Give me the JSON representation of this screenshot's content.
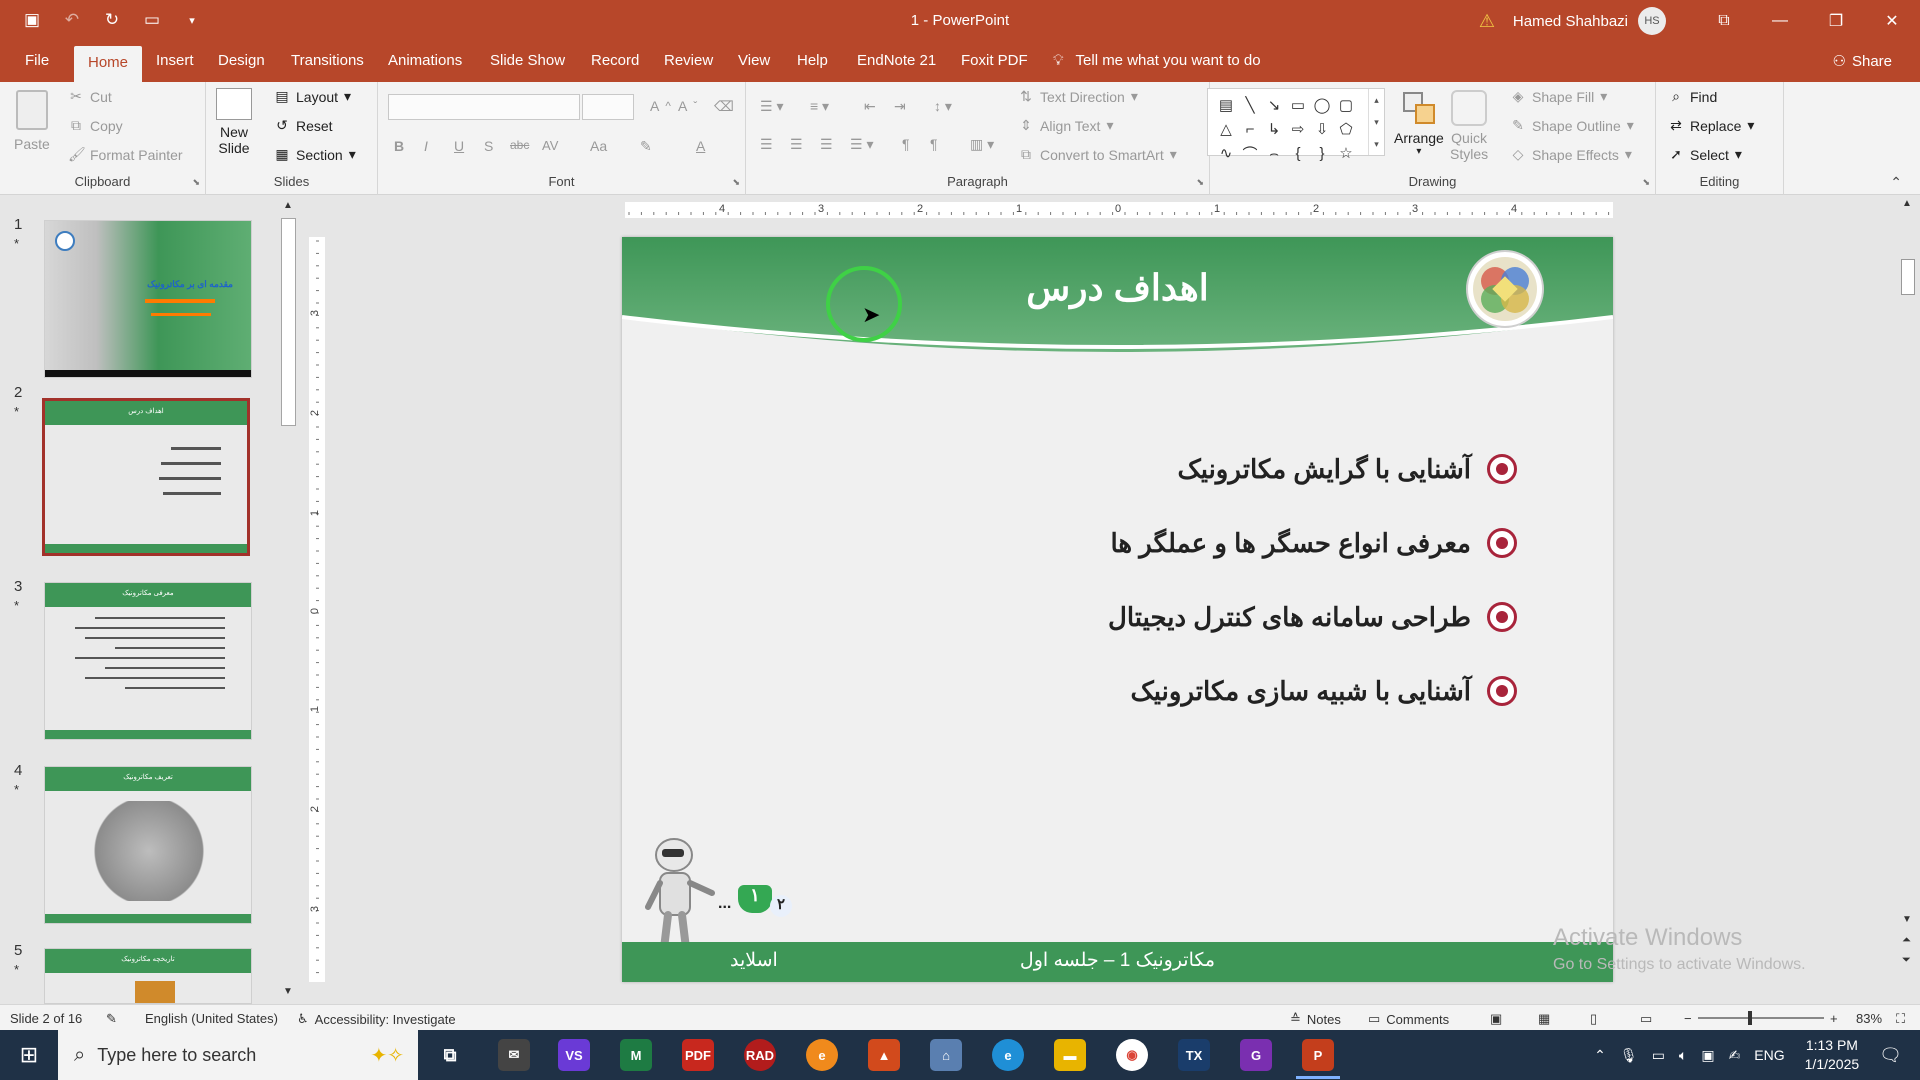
{
  "window": {
    "title": "1  -  PowerPoint",
    "user_name": "Hamed Shahbazi",
    "user_initials": "HS"
  },
  "quick_access": [
    "save-icon",
    "undo-icon",
    "redo-icon",
    "present-icon",
    "customize-icon"
  ],
  "ribbon_tabs": [
    "File",
    "Home",
    "Insert",
    "Design",
    "Transitions",
    "Animations",
    "Slide Show",
    "Record",
    "Review",
    "View",
    "Help",
    "EndNote 21",
    "Foxit PDF"
  ],
  "active_tab": "Home",
  "tell_me": "Tell me what you want to do",
  "share_label": "Share",
  "clipboard": {
    "paste": "Paste",
    "cut": "Cut",
    "copy": "Copy",
    "format_painter": "Format Painter",
    "label": "Clipboard"
  },
  "slides_group": {
    "new_slide_1": "New",
    "new_slide_2": "Slide",
    "layout": "Layout",
    "reset": "Reset",
    "section": "Section",
    "label": "Slides"
  },
  "font_group": {
    "label": "Font",
    "buttons": [
      "B",
      "I",
      "U",
      "S",
      "abc",
      "AV",
      "Aa",
      "A"
    ]
  },
  "paragraph_group": {
    "label": "Paragraph",
    "text_direction": "Text Direction",
    "align_text": "Align Text",
    "convert_smartart": "Convert to SmartArt"
  },
  "drawing_group": {
    "label": "Drawing",
    "arrange": "Arrange",
    "quick_1": "Quick",
    "quick_2": "Styles",
    "shape_fill": "Shape Fill",
    "shape_outline": "Shape Outline",
    "shape_effects": "Shape Effects"
  },
  "editing_group": {
    "label": "Editing",
    "find": "Find",
    "replace": "Replace",
    "select": "Select"
  },
  "slides_panel": {
    "slides": [
      {
        "num": "1",
        "mark": "*",
        "title": "مقدمه ای بر مکاترونیک"
      },
      {
        "num": "2",
        "mark": "*",
        "title": "اهداف درس"
      },
      {
        "num": "3",
        "mark": "*",
        "title": "معرفی مکاترونیک"
      },
      {
        "num": "4",
        "mark": "*",
        "title": "تعریف مکاترونیک"
      },
      {
        "num": "5",
        "mark": "*",
        "title": "تاریخچه مکاترونیک"
      }
    ]
  },
  "ruler": {
    "h_labels": [
      "4",
      "3",
      "2",
      "1",
      "0",
      "1",
      "2",
      "3",
      "4"
    ],
    "v_labels": [
      "3",
      "2",
      "1",
      "0",
      "1",
      "2",
      "3"
    ]
  },
  "slide": {
    "title": "اهداف درس",
    "bullets": [
      "آشنایی با گرایش مکاترونیک",
      "معرفی انواع حسگر ها و عملگر ها",
      "طراحی سامانه های کنترل دیجیتال",
      "آشنایی با شبیه سازی مکاترونیک"
    ],
    "footer_center": "مکاترونیک 1 – جلسه اول",
    "footer_left": "اسلاید",
    "flag_1": "۱",
    "flag_2": "۲",
    "dots": "..."
  },
  "watermark": {
    "line1": "Activate Windows",
    "line2": "Go to Settings to activate Windows."
  },
  "status": {
    "slide_of": "Slide 2 of 16",
    "language": "English (United States)",
    "accessibility": "Accessibility: Investigate",
    "notes": "Notes",
    "comments": "Comments",
    "zoom": "83%"
  },
  "taskbar": {
    "search_placeholder": "Type here to search",
    "lang": "ENG",
    "time": "1:13 PM",
    "date": "1/1/2025"
  },
  "colors": {
    "accent": "#b7472a",
    "slide_green": "#3e9657",
    "bullet_red": "#a8243b",
    "cursor_ring": "#3fd146"
  }
}
